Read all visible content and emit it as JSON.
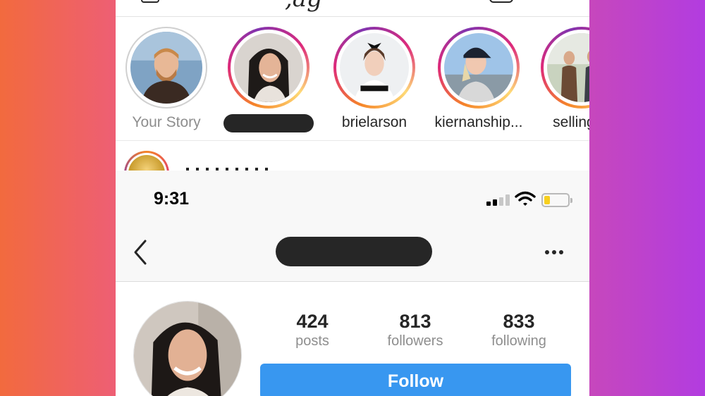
{
  "stories_panel": {
    "stories": [
      {
        "label": "Your Story",
        "ring": "seen",
        "redacted": false
      },
      {
        "label": "",
        "ring": "unseen",
        "redacted": true
      },
      {
        "label": "brielarson",
        "ring": "unseen",
        "redacted": false
      },
      {
        "label": "kiernanship...",
        "ring": "unseen",
        "redacted": false
      },
      {
        "label": "selling_k",
        "ring": "unseen",
        "redacted": false
      }
    ]
  },
  "profile_panel": {
    "status_bar": {
      "time": "9:31",
      "signal_icon": "cellular-signal-icon",
      "wifi_icon": "wifi-icon",
      "battery_icon": "battery-low-icon",
      "battery_level": 0.25
    },
    "nav": {
      "back_icon": "chevron-left-icon",
      "title_redacted": true,
      "more_icon": "more-horizontal-icon"
    },
    "stats": [
      {
        "value": "424",
        "label": "posts"
      },
      {
        "value": "813",
        "label": "followers"
      },
      {
        "value": "833",
        "label": "following"
      }
    ],
    "follow_label": "Follow"
  },
  "colors": {
    "background_left": "#f26a3e",
    "background_right": "#b23ce0",
    "follow_button": "#3897f0",
    "battery_fill": "#f7cf1f",
    "text_primary": "#262626",
    "text_muted": "#8e8e8e"
  }
}
